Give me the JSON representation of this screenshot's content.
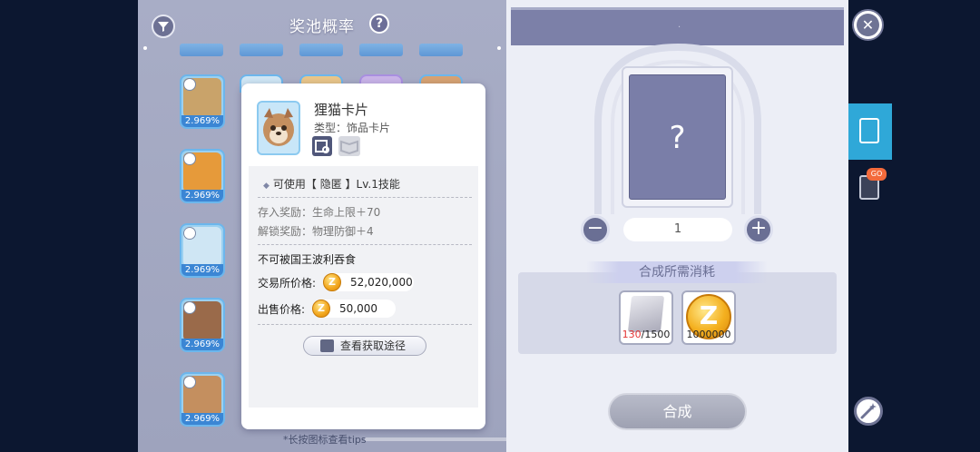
{
  "pool": {
    "title": "奖池概率",
    "help_icon": "question-icon",
    "filter_icon": "filter-icon",
    "card_percent": "2.969%",
    "footnote": "*长按图标查看tips",
    "cards": [
      {
        "color": "#c9a36a"
      },
      {
        "color": "#e69a3a"
      },
      {
        "color": "#cfe6f4"
      },
      {
        "color": "#9a6a4a"
      },
      {
        "color": "#c48f5f"
      }
    ]
  },
  "popup": {
    "item_name": "狸猫卡片",
    "item_type": "类型：饰品卡片",
    "skill_text": "可使用【 隐匿 】Lv.1技能",
    "deposit_reward": "存入奖励：生命上限＋70",
    "unlock_reward": "解锁奖励：物理防御＋4",
    "restriction": "不可被国王波利吞食",
    "exchange_price_label": "交易所价格:",
    "exchange_price": "52,020,000",
    "sell_price_label": "出售价格:",
    "sell_price": "50,000",
    "coin_symbol": "Z",
    "source_button": "查看获取途径"
  },
  "synth": {
    "topbar_mark": "·",
    "card_symbol": "?",
    "quantity": "1",
    "minus": "−",
    "plus": "+",
    "required_label": "合成所需消耗",
    "materials": {
      "stone_have": "130",
      "stone_need": "/1500",
      "zeny_amount": "1000000",
      "coin_symbol": "Z"
    },
    "button": "合成"
  },
  "side": {
    "close": "✕",
    "badge": "GO"
  }
}
